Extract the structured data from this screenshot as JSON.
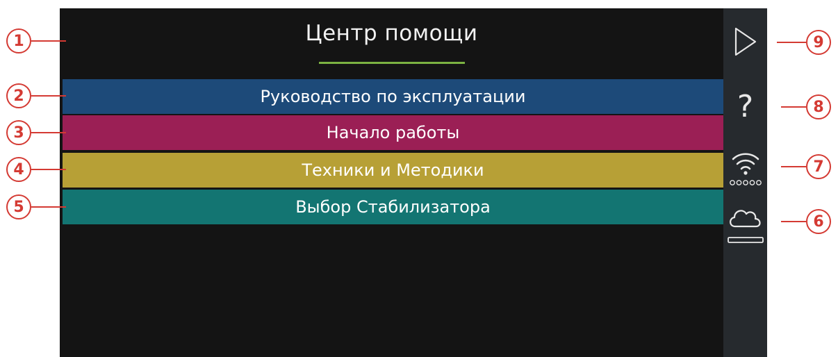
{
  "header": {
    "title": "Центр помощи",
    "underline_color": "#7cb342"
  },
  "menu": {
    "items": [
      {
        "label": "Руководство по эксплуатации",
        "color": "#1d4a79"
      },
      {
        "label": "Начало работы",
        "color": "#9b1f55"
      },
      {
        "label": "Техники и Методики",
        "color": "#b7a036"
      },
      {
        "label": "Выбор Стабилизатора",
        "color": "#137572"
      }
    ]
  },
  "sidebar": {
    "icons": [
      "play-icon",
      "help-icon",
      "wifi-icon",
      "cloud-icon"
    ],
    "help_glyph": "?"
  },
  "callouts": [
    "1",
    "2",
    "3",
    "4",
    "5",
    "6",
    "7",
    "8",
    "9"
  ],
  "colors": {
    "screen": "#141414",
    "sidebar": "#262a2e",
    "callout": "#d43a33"
  }
}
